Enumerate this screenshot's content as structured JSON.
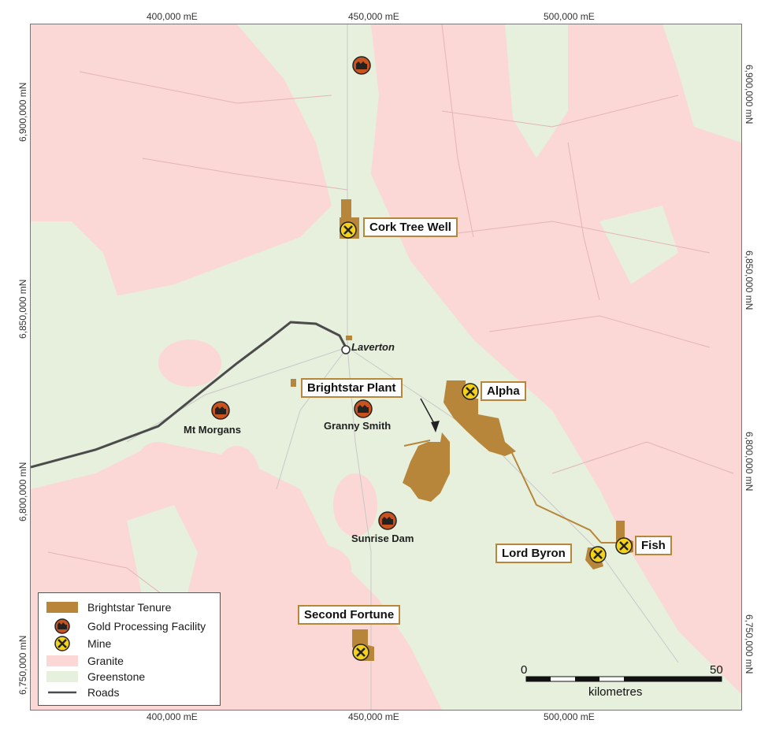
{
  "grid": {
    "top_easting": [
      "400,000 mE",
      "450,000 mE",
      "500,000 mE"
    ],
    "bottom_easting": [
      "400,000 mE",
      "450,000 mE",
      "500,000 mE"
    ],
    "left_northing": [
      "6,900,000 mN",
      "6,850,000 mN",
      "6,800,000 mN",
      "6,750,000 mN"
    ],
    "right_northing": [
      "6,900,000 mN",
      "6,850,000 mN",
      "6,800,000 mN",
      "6,750,000 mN"
    ]
  },
  "places": {
    "cork_tree_well": "Cork Tree Well",
    "laverton": "Laverton",
    "brightstar_plant": "Brightstar Plant",
    "alpha": "Alpha",
    "mt_morgans": "Mt Morgans",
    "granny_smith": "Granny Smith",
    "sunrise_dam": "Sunrise Dam",
    "lord_byron": "Lord Byron",
    "fish": "Fish",
    "second_fortune": "Second Fortune"
  },
  "legend": {
    "tenure": "Brightstar Tenure",
    "gold": "Gold Processing Facility",
    "mine": "Mine",
    "granite": "Granite",
    "greenstone": "Greenstone",
    "roads": "Roads"
  },
  "scale": {
    "start": "0",
    "end": "50",
    "unit": "kilometres"
  },
  "colors": {
    "granite": "#fbd7d6",
    "greenstone": "#e6f0dc",
    "tenure": "#b7863a",
    "road": "#4b4b4b",
    "facility": "#c8531f",
    "mine": "#f4d21b"
  },
  "icons": {
    "facility": "factory-icon",
    "mine": "pick-axe-icon"
  }
}
